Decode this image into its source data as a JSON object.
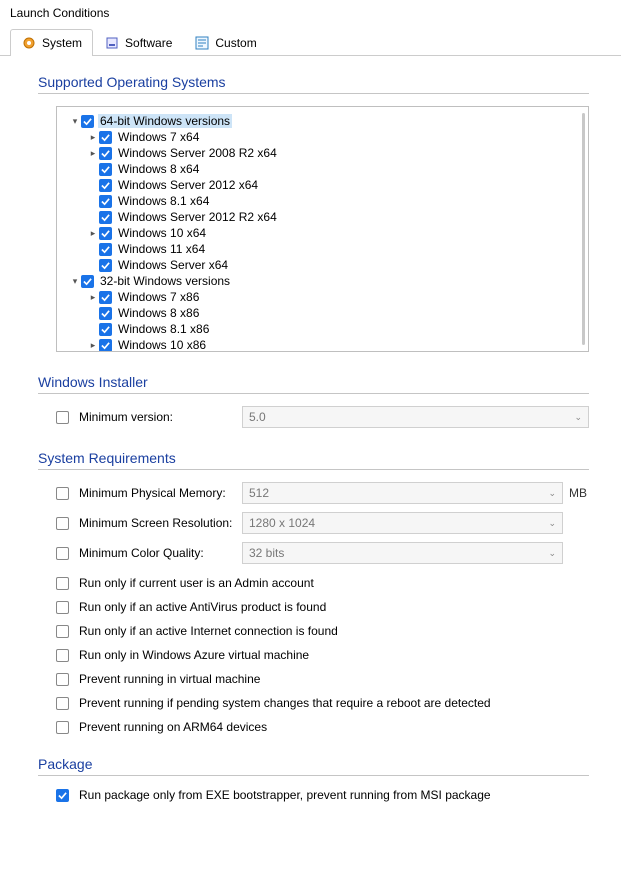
{
  "window_title": "Launch Conditions",
  "tabs": [
    {
      "label": "System",
      "active": true
    },
    {
      "label": "Software",
      "active": false
    },
    {
      "label": "Custom",
      "active": false
    }
  ],
  "sections": {
    "os": {
      "title": "Supported Operating Systems",
      "tree": [
        {
          "depth": 0,
          "expander": "down",
          "checked": true,
          "label": "64-bit Windows versions",
          "selected": true
        },
        {
          "depth": 1,
          "expander": "right",
          "checked": true,
          "label": "Windows 7 x64"
        },
        {
          "depth": 1,
          "expander": "right",
          "checked": true,
          "label": "Windows Server 2008 R2 x64"
        },
        {
          "depth": 1,
          "expander": "",
          "checked": true,
          "label": "Windows 8 x64"
        },
        {
          "depth": 1,
          "expander": "",
          "checked": true,
          "label": "Windows Server 2012 x64"
        },
        {
          "depth": 1,
          "expander": "",
          "checked": true,
          "label": "Windows 8.1 x64"
        },
        {
          "depth": 1,
          "expander": "",
          "checked": true,
          "label": "Windows Server 2012 R2 x64"
        },
        {
          "depth": 1,
          "expander": "right",
          "checked": true,
          "label": "Windows 10 x64"
        },
        {
          "depth": 1,
          "expander": "",
          "checked": true,
          "label": "Windows 11 x64"
        },
        {
          "depth": 1,
          "expander": "",
          "checked": true,
          "label": "Windows Server x64"
        },
        {
          "depth": 0,
          "expander": "down",
          "checked": true,
          "label": "32-bit Windows versions"
        },
        {
          "depth": 1,
          "expander": "right",
          "checked": true,
          "label": "Windows 7 x86"
        },
        {
          "depth": 1,
          "expander": "",
          "checked": true,
          "label": "Windows 8 x86"
        },
        {
          "depth": 1,
          "expander": "",
          "checked": true,
          "label": "Windows 8.1 x86"
        },
        {
          "depth": 1,
          "expander": "right",
          "checked": true,
          "label": "Windows 10 x86"
        }
      ]
    },
    "installer": {
      "title": "Windows Installer",
      "min_version_label": "Minimum version:",
      "min_version_checked": false,
      "min_version_value": "5.0"
    },
    "sysreq": {
      "title": "System Requirements",
      "memory_label": "Minimum Physical Memory:",
      "memory_checked": false,
      "memory_value": "512",
      "memory_unit": "MB",
      "screen_label": "Minimum Screen Resolution:",
      "screen_checked": false,
      "screen_value": "1280 x 1024",
      "color_label": "Minimum Color Quality:",
      "color_checked": false,
      "color_value": "32 bits",
      "checks": [
        {
          "checked": false,
          "label": "Run only if current user is an Admin account"
        },
        {
          "checked": false,
          "label": "Run only if an active AntiVirus product is found"
        },
        {
          "checked": false,
          "label": "Run only if an active Internet connection is found"
        },
        {
          "checked": false,
          "label": "Run only in Windows Azure virtual machine"
        },
        {
          "checked": false,
          "label": "Prevent running in virtual machine"
        },
        {
          "checked": false,
          "label": "Prevent running if pending system changes that require a reboot are detected"
        },
        {
          "checked": false,
          "label": "Prevent running on ARM64 devices"
        }
      ]
    },
    "package": {
      "title": "Package",
      "exe_only_checked": true,
      "exe_only_label": "Run package only from EXE bootstrapper, prevent running from MSI package"
    }
  }
}
